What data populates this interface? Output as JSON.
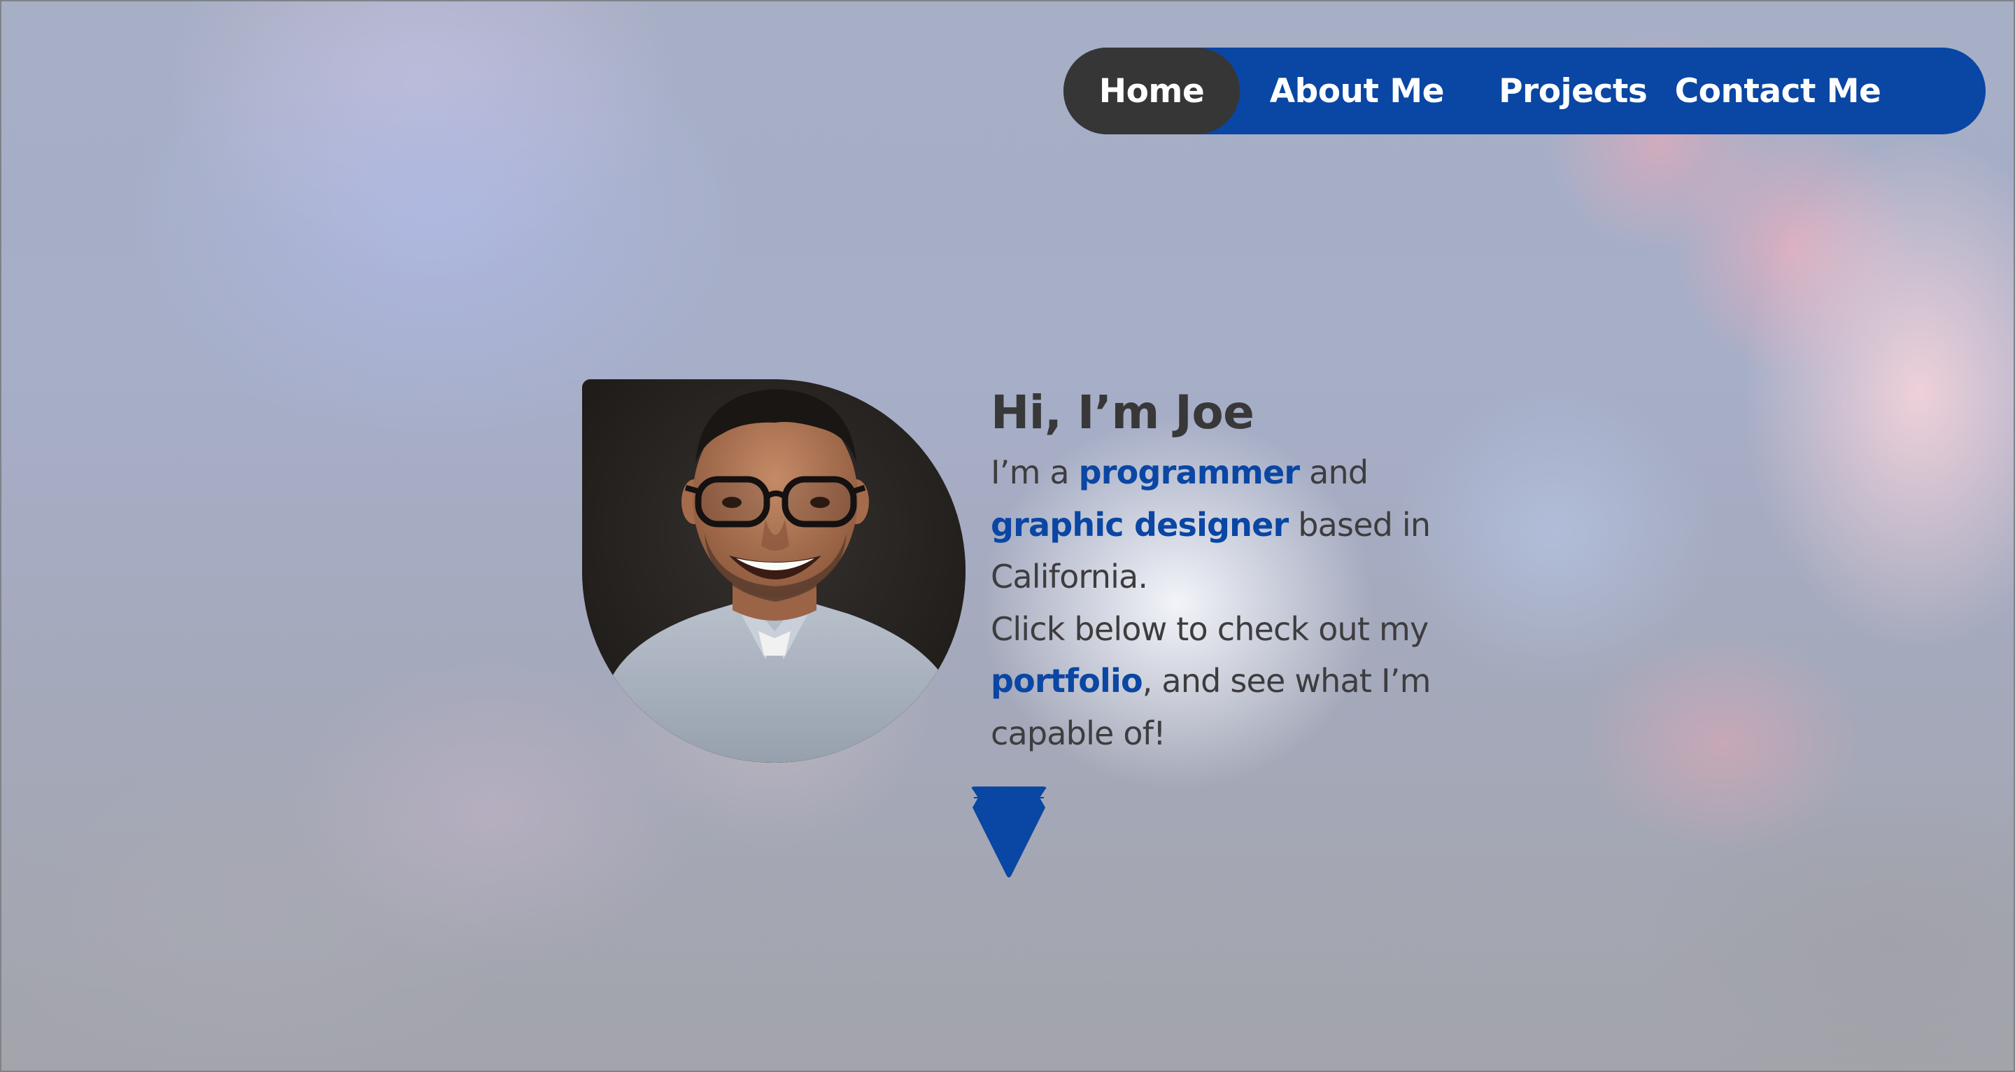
{
  "nav": {
    "items": [
      {
        "label": "Home",
        "active": true
      },
      {
        "label": "About Me",
        "active": false
      },
      {
        "label": "Projects",
        "active": false
      },
      {
        "label": "Contact Me",
        "active": false
      }
    ]
  },
  "hero": {
    "heading": "Hi, I’m Joe",
    "bio": {
      "part1": "I’m a ",
      "highlight1": "programmer",
      "part2": " and ",
      "highlight2": "graphic designer",
      "part3": " based in California.",
      "part4": "Click below to check out my ",
      "highlight3": "portfolio",
      "part5": ", and see what I’m capable of!"
    }
  },
  "icons": {
    "profile_photo": "profile-photo",
    "scroll": "down-arrow-icon"
  },
  "colors": {
    "accent": "#0a46a3",
    "active_nav": "#363636",
    "text": "#3d3d3f"
  }
}
